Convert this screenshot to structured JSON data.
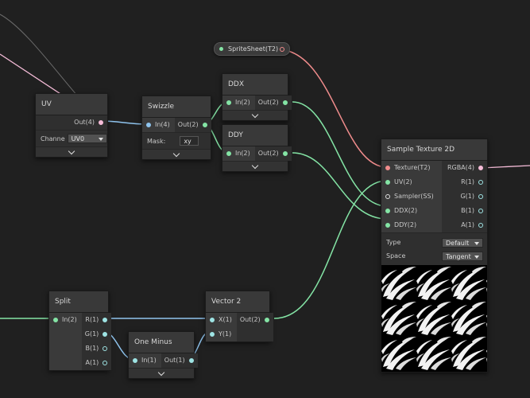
{
  "property_node": {
    "label": "SpriteSheet(T2)"
  },
  "uv_node": {
    "title": "UV",
    "out_label": "Out(4)",
    "channel_label": "Channe",
    "channel_value": "UV0"
  },
  "swizzle_node": {
    "title": "Swizzle",
    "in_label": "In(4)",
    "out_label": "Out(2)",
    "mask_label": "Mask:",
    "mask_value": "xy"
  },
  "ddx_node": {
    "title": "DDX",
    "in_label": "In(2)",
    "out_label": "Out(2)"
  },
  "ddy_node": {
    "title": "DDY",
    "in_label": "In(2)",
    "out_label": "Out(2)"
  },
  "sample_node": {
    "title": "Sample Texture 2D",
    "inputs": [
      "Texture(T2)",
      "UV(2)",
      "Sampler(SS)",
      "DDX(2)",
      "DDY(2)"
    ],
    "outputs": [
      "RGBA(4)",
      "R(1)",
      "G(1)",
      "B(1)",
      "A(1)"
    ],
    "type_label": "Type",
    "type_value": "Default",
    "space_label": "Space",
    "space_value": "Tangent"
  },
  "split_node": {
    "title": "Split",
    "in_label": "In(2)",
    "outputs": [
      "R(1)",
      "G(1)",
      "B(1)",
      "A(1)"
    ]
  },
  "one_minus_node": {
    "title": "One Minus",
    "in_label": "In(1)",
    "out_label": "Out(1)"
  },
  "vector2_node": {
    "title": "Vector 2",
    "inputs": [
      "X(1)",
      "Y(1)"
    ],
    "out_label": "Out(2)"
  },
  "colors": {
    "canvas": "#202020",
    "vector2_wire": "#84e4a5",
    "vector4_wire": "#f5bcd8",
    "texture_wire": "#f08c8c",
    "float_wire": "#8fc4ee"
  }
}
